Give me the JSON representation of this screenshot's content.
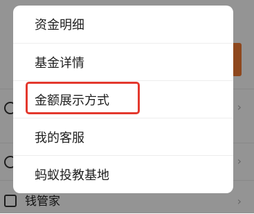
{
  "background": {
    "bottom_item_label": "钱管家"
  },
  "menu": {
    "items": [
      {
        "label": "资金明细"
      },
      {
        "label": "基金详情"
      },
      {
        "label": "金额展示方式"
      },
      {
        "label": "我的客服"
      },
      {
        "label": "蚂蚁投教基地"
      }
    ],
    "highlighted_index": 2
  },
  "colors": {
    "highlight": "#e3382d",
    "accent_orange": "#f47a32"
  }
}
